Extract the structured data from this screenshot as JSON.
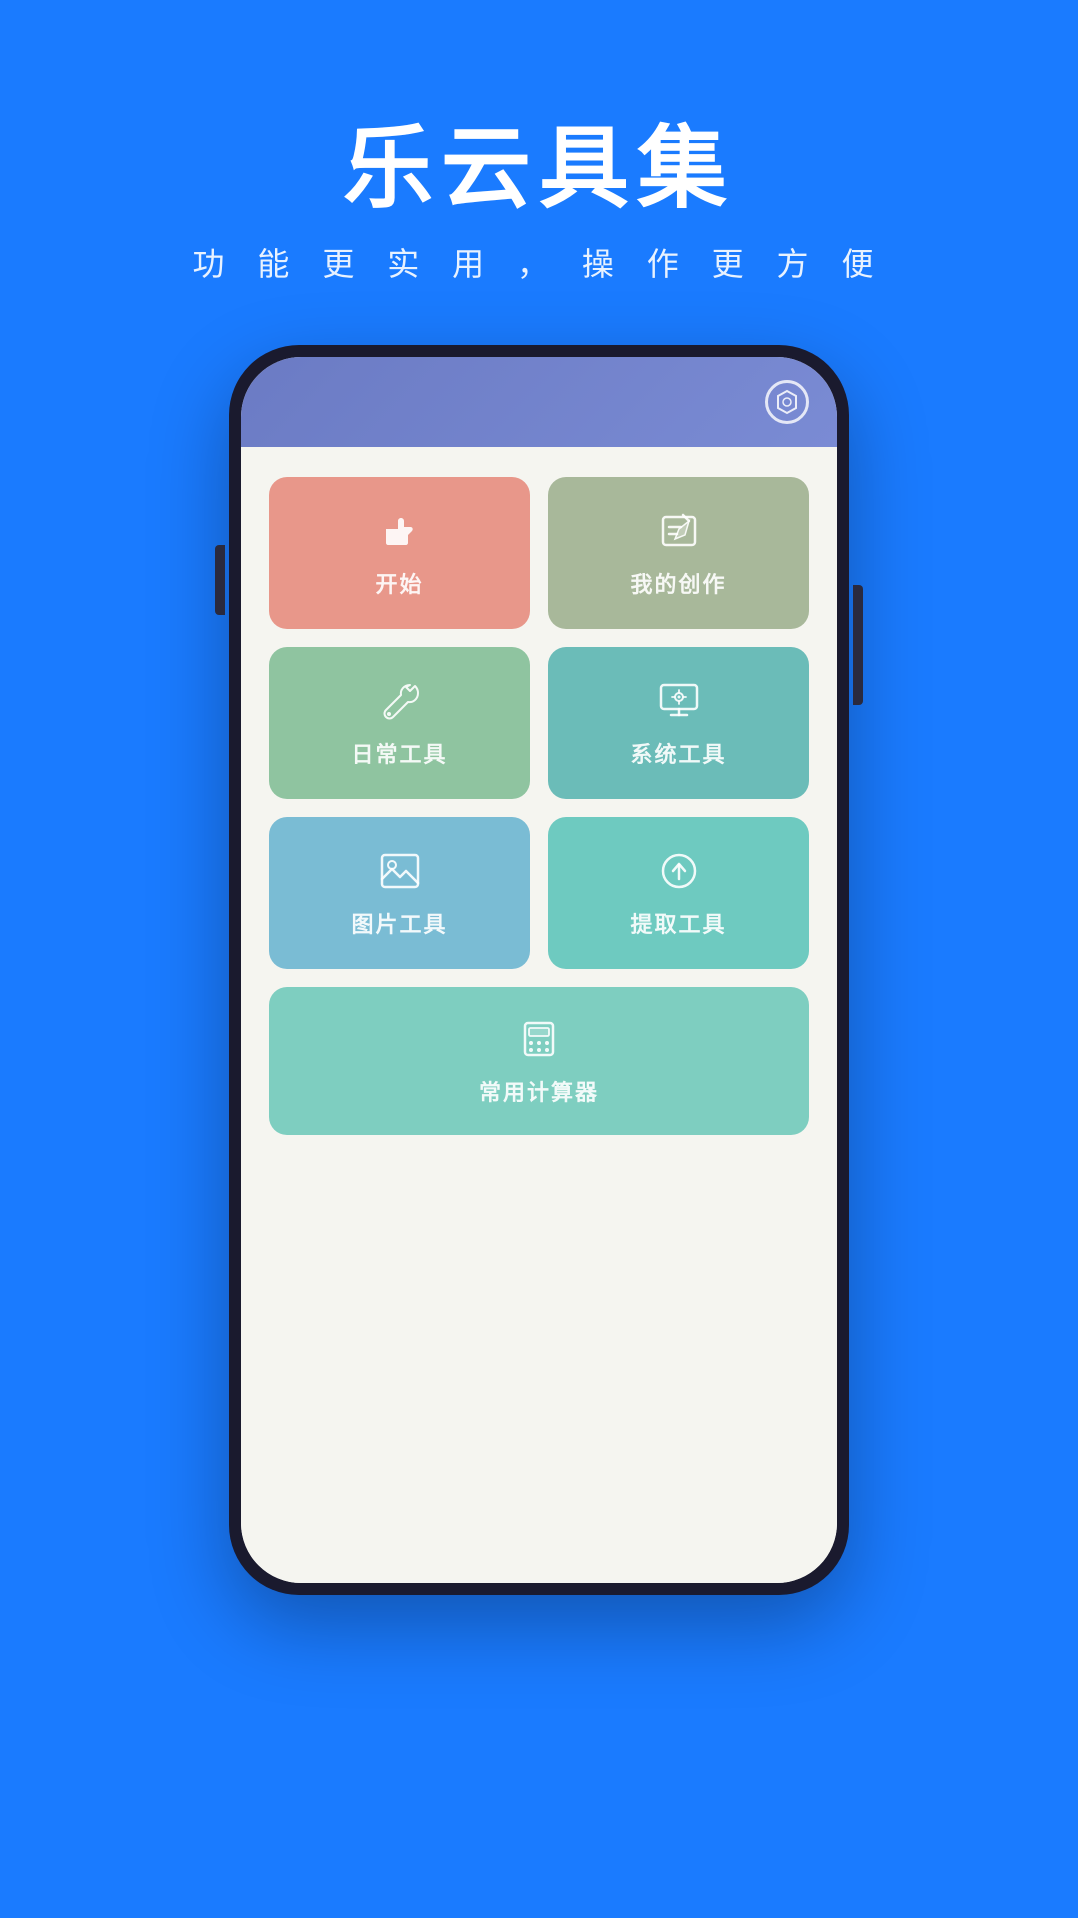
{
  "header": {
    "title": "乐云具集",
    "subtitle": "功 能 更 实 用 ， 操 作 更 方 便"
  },
  "phone": {
    "settings_icon": "⚙",
    "tiles": [
      {
        "id": "start",
        "label": "开始",
        "color_class": "tile-pink",
        "icon": "start"
      },
      {
        "id": "my-creation",
        "label": "我的创作",
        "color_class": "tile-sage",
        "icon": "folder"
      },
      {
        "id": "daily-tools",
        "label": "日常工具",
        "color_class": "tile-green",
        "icon": "wrench"
      },
      {
        "id": "system-tools",
        "label": "系统工具",
        "color_class": "tile-teal",
        "icon": "monitor"
      },
      {
        "id": "image-tools",
        "label": "图片工具",
        "color_class": "tile-blue1",
        "icon": "image"
      },
      {
        "id": "extract-tools",
        "label": "提取工具",
        "color_class": "tile-blue2",
        "icon": "upload"
      },
      {
        "id": "calculator",
        "label": "常用计算器",
        "color_class": "tile-mint",
        "icon": "calculator"
      }
    ]
  }
}
